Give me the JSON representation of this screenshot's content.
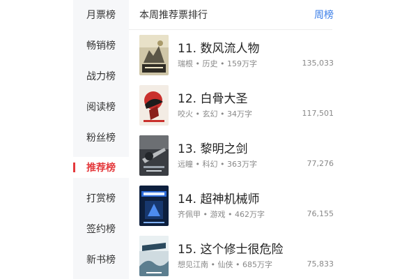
{
  "sidebar": {
    "items": [
      {
        "label": "月票榜",
        "active": false
      },
      {
        "label": "畅销榜",
        "active": false
      },
      {
        "label": "战力榜",
        "active": false
      },
      {
        "label": "阅读榜",
        "active": false
      },
      {
        "label": "粉丝榜",
        "active": false
      },
      {
        "label": "推荐榜",
        "active": true
      },
      {
        "label": "打赏榜",
        "active": false
      },
      {
        "label": "签约榜",
        "active": false
      },
      {
        "label": "新书榜",
        "active": false
      }
    ]
  },
  "header": {
    "title": "本周推荐票排行",
    "period": "周榜"
  },
  "books": [
    {
      "rank_title": "11. 数风流人物",
      "meta": "瑞根 • 历史 • 159万字",
      "votes": "135,033",
      "cover_title": "数风流人物"
    },
    {
      "rank_title": "12. 白骨大圣",
      "meta": "咬火 • 玄幻 • 34万字",
      "votes": "117,501",
      "cover_title": "白骨大圣"
    },
    {
      "rank_title": "13. 黎明之剑",
      "meta": "远瞳 • 科幻 • 363万字",
      "votes": "77,276",
      "cover_title": "黎明之剑"
    },
    {
      "rank_title": "14. 超神机械师",
      "meta": "齐佩甲 • 游戏 • 462万字",
      "votes": "76,155",
      "cover_title": "超神机械师"
    },
    {
      "rank_title": "15. 这个修士很危险",
      "meta": "想见江南 • 仙侠 • 685万字",
      "votes": "75,833",
      "cover_title": "这个修士很危险"
    }
  ]
}
